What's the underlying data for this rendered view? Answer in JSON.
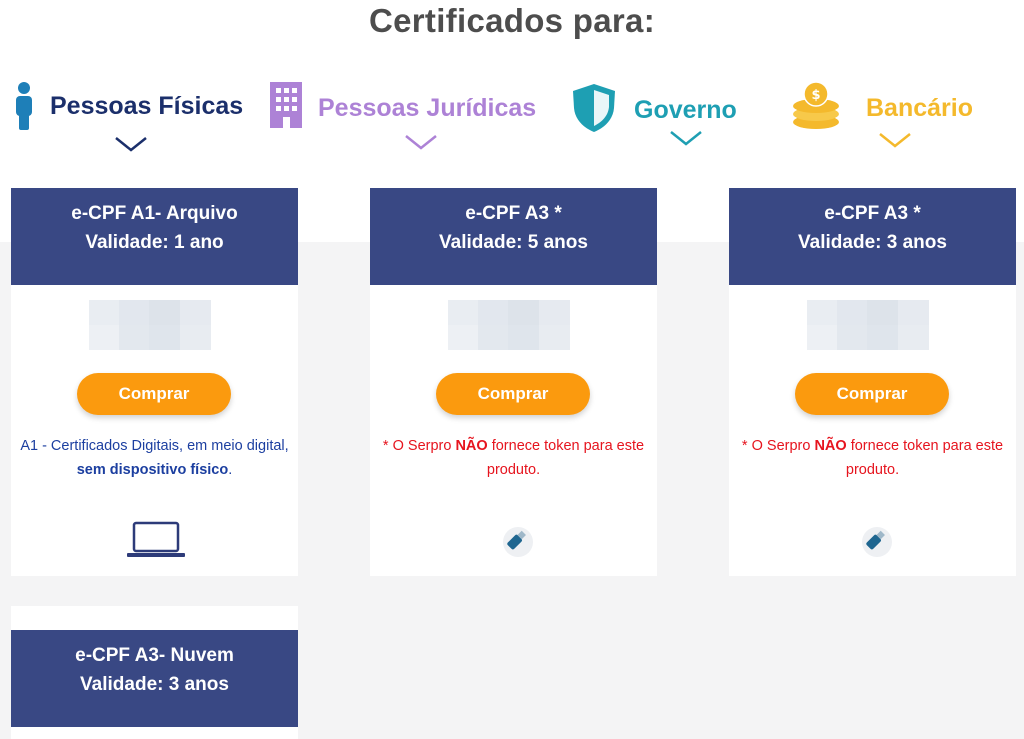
{
  "page": {
    "title": "Certificados para:"
  },
  "categories": [
    {
      "id": "pf",
      "label": "Pessoas Físicas",
      "icon": "person-icon",
      "color": "#1b2f6b",
      "icon_color": "#1e7fb8"
    },
    {
      "id": "pj",
      "label": "Pessoas Jurídicas",
      "icon": "building-icon",
      "color": "#ad82d6"
    },
    {
      "id": "gov",
      "label": "Governo",
      "icon": "shield-icon",
      "color": "#1e9fb3"
    },
    {
      "id": "banc",
      "label": "Bancário",
      "icon": "coins-icon",
      "color": "#f4b92c"
    }
  ],
  "cards": [
    {
      "title": "e-CPF A1- Arquivo",
      "validity": "Validade: 1 ano",
      "button": "Comprar",
      "desc_parts": [
        "A1 - Certificados Digitais, em meio digital, ",
        "sem dispositivo físico",
        "."
      ],
      "icon": "laptop-icon"
    },
    {
      "title": "e-CPF A3 *",
      "validity": "Validade: 5 anos",
      "button": "Comprar",
      "note_parts": [
        "* O Serpro ",
        "NÃO",
        " fornece token para este produto."
      ],
      "icon": "usb-token-icon"
    },
    {
      "title": "e-CPF A3 *",
      "validity": "Validade: 3 anos",
      "button": "Comprar",
      "note_parts": [
        "* O Serpro ",
        "NÃO",
        " fornece token para este produto."
      ],
      "icon": "usb-token-icon"
    },
    {
      "title": "e-CPF A3- Nuvem",
      "validity": "Validade: 3 anos"
    }
  ],
  "colors": {
    "card_header": "#394884",
    "button": "#fb9a0e",
    "red_note": "#e6141e",
    "blue_desc": "#1c3fa0"
  }
}
